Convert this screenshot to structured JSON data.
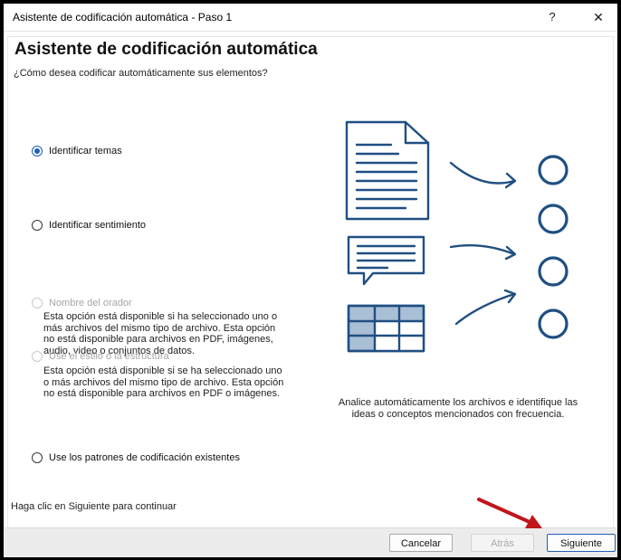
{
  "window": {
    "title": "Asistente de codificación automática - Paso 1",
    "help_label": "?",
    "close_label": "✕"
  },
  "header": {
    "title": "Asistente de codificación automática",
    "question": "¿Cómo desea codificar automáticamente sus elementos?"
  },
  "options": [
    {
      "label": "Identificar temas",
      "selected": true,
      "enabled": true
    },
    {
      "label": "Identificar sentimiento",
      "selected": false,
      "enabled": true
    },
    {
      "label": "Nombre del orador",
      "selected": false,
      "enabled": false,
      "description": [
        "Esta opción está disponible si ha seleccionado uno o",
        "más archivos del mismo tipo de archivo. Esta opción",
        "no está disponible para archivos en PDF, imágenes,",
        "audio, video o conjuntos de datos."
      ]
    },
    {
      "label": "Use el estilo o la estructura",
      "selected": false,
      "enabled": false,
      "description": [
        "Esta opción está disponible si se ha seleccionado uno",
        "o más archivos del mismo tipo de archivo. Esta opción",
        "no está disponible para archivos en PDF o imágenes."
      ]
    },
    {
      "label": "Use los patrones de codificación existentes",
      "selected": false,
      "enabled": true
    }
  ],
  "illustration": {
    "caption": [
      "Analice automáticamente los archivos e identifique las",
      "ideas o conceptos mencionados con frecuencia."
    ],
    "icons": [
      "document-icon",
      "speech-bubble-icon",
      "table-icon",
      "arrow-icon",
      "circle-icon"
    ],
    "color": "#1f4f82",
    "accent_fill": "#a9bfd6"
  },
  "footer": {
    "hint": "Haga clic en Siguiente para continuar",
    "cancel_label": "Cancelar",
    "back_label": "Atrás",
    "next_label": "Siguiente"
  },
  "annotation": {
    "icon": "red-arrow-icon",
    "color": "#c0171c"
  }
}
